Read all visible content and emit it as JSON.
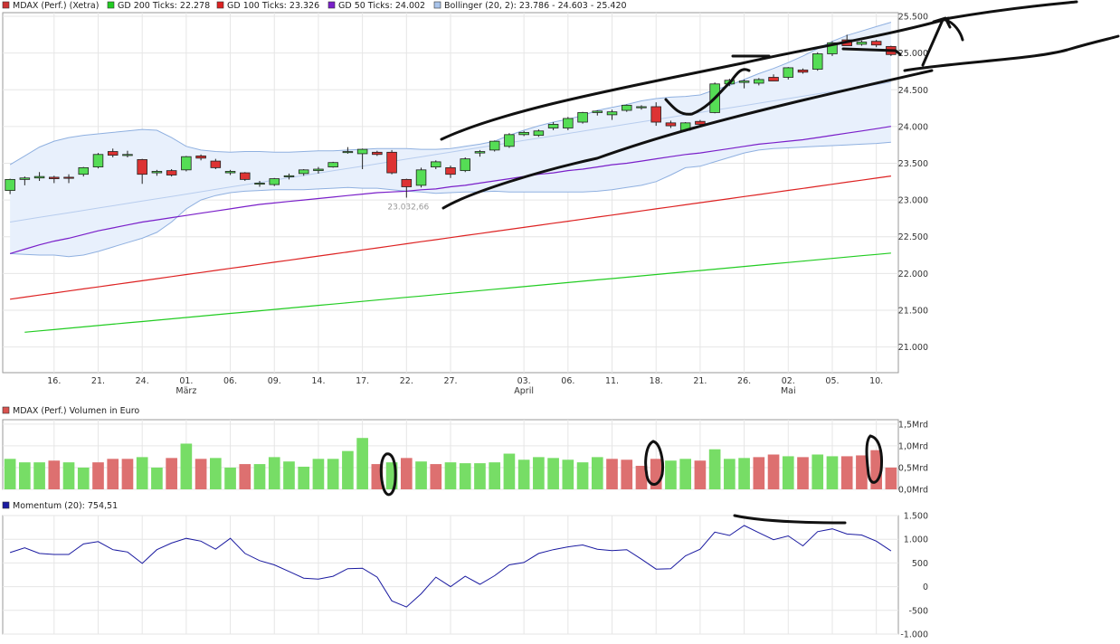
{
  "legend_main": [
    {
      "label": "MDAX (Perf.) (Xetra)",
      "color": "#333333"
    },
    {
      "label": "GD 200 Ticks: 22.278",
      "color": "#22cc22"
    },
    {
      "label": "GD 100 Ticks: 23.326",
      "color": "#dd2222"
    },
    {
      "label": "GD 50 Ticks: 24.002",
      "color": "#7a1fc9"
    },
    {
      "label": "Bollinger (20, 2): 23.786 - 24.603 - 25.420",
      "color": "#a9c4ea"
    }
  ],
  "legend_volume": {
    "label": "MDAX (Perf.) Volumen in Euro",
    "color": "#d9534f"
  },
  "legend_momentum": {
    "label": "Momentum (20): 754,51",
    "color": "#1a1aa0"
  },
  "annotations": {
    "low_label": "23.032,66"
  },
  "colors": {
    "up": "#55dd55",
    "down": "#dd3333",
    "vol_up": "#77dd66",
    "vol_down": "#dd7070",
    "gd200": "#22cc22",
    "gd100": "#dd2222",
    "gd50": "#7a1fc9",
    "boll_fill": "#e8f0fc",
    "boll_line": "#8fb0e0",
    "momentum": "#1a1aa0",
    "grid": "#e6e6e6"
  },
  "chart_data": [
    {
      "type": "candlestick",
      "title": "MDAX (Perf.) (Xetra)",
      "ylim": [
        20650,
        25550
      ],
      "y_ticks": [
        "21.000",
        "21.500",
        "22.000",
        "22.500",
        "23.000",
        "23.500",
        "24.000",
        "24.500",
        "25.000",
        "25.500"
      ],
      "y_tick_values": [
        21000,
        21500,
        22000,
        22500,
        23000,
        23500,
        24000,
        24500,
        25000,
        25500
      ],
      "x_ticks": [
        {
          "i": 3,
          "label": "16.",
          "sub": ""
        },
        {
          "i": 6,
          "label": "21.",
          "sub": ""
        },
        {
          "i": 9,
          "label": "24.",
          "sub": ""
        },
        {
          "i": 12,
          "label": "01.",
          "sub": "März"
        },
        {
          "i": 15,
          "label": "06.",
          "sub": ""
        },
        {
          "i": 18,
          "label": "09.",
          "sub": ""
        },
        {
          "i": 21,
          "label": "14.",
          "sub": ""
        },
        {
          "i": 24,
          "label": "17.",
          "sub": ""
        },
        {
          "i": 27,
          "label": "22.",
          "sub": ""
        },
        {
          "i": 30,
          "label": "27.",
          "sub": ""
        },
        {
          "i": 35,
          "label": "03.",
          "sub": "April"
        },
        {
          "i": 38,
          "label": "06.",
          "sub": ""
        },
        {
          "i": 41,
          "label": "11.",
          "sub": ""
        },
        {
          "i": 44,
          "label": "18.",
          "sub": ""
        },
        {
          "i": 47,
          "label": "21.",
          "sub": ""
        },
        {
          "i": 50,
          "label": "26.",
          "sub": ""
        },
        {
          "i": 53,
          "label": "02.",
          "sub": "Mai"
        },
        {
          "i": 56,
          "label": "05.",
          "sub": ""
        },
        {
          "i": 59,
          "label": "10.",
          "sub": ""
        }
      ],
      "candles": [
        {
          "o": 23130,
          "h": 23290,
          "l": 23080,
          "c": 23280
        },
        {
          "o": 23280,
          "h": 23320,
          "l": 23200,
          "c": 23300
        },
        {
          "o": 23300,
          "h": 23380,
          "l": 23260,
          "c": 23320
        },
        {
          "o": 23310,
          "h": 23330,
          "l": 23230,
          "c": 23290
        },
        {
          "o": 23310,
          "h": 23350,
          "l": 23230,
          "c": 23300
        },
        {
          "o": 23350,
          "h": 23450,
          "l": 23320,
          "c": 23440
        },
        {
          "o": 23450,
          "h": 23640,
          "l": 23430,
          "c": 23620
        },
        {
          "o": 23660,
          "h": 23700,
          "l": 23580,
          "c": 23610
        },
        {
          "o": 23610,
          "h": 23670,
          "l": 23580,
          "c": 23620
        },
        {
          "o": 23550,
          "h": 23560,
          "l": 23220,
          "c": 23350
        },
        {
          "o": 23370,
          "h": 23410,
          "l": 23330,
          "c": 23390
        },
        {
          "o": 23400,
          "h": 23420,
          "l": 23320,
          "c": 23340
        },
        {
          "o": 23410,
          "h": 23600,
          "l": 23390,
          "c": 23590
        },
        {
          "o": 23600,
          "h": 23620,
          "l": 23540,
          "c": 23570
        },
        {
          "o": 23530,
          "h": 23560,
          "l": 23420,
          "c": 23440
        },
        {
          "o": 23370,
          "h": 23410,
          "l": 23340,
          "c": 23390
        },
        {
          "o": 23370,
          "h": 23380,
          "l": 23260,
          "c": 23280
        },
        {
          "o": 23220,
          "h": 23260,
          "l": 23180,
          "c": 23230
        },
        {
          "o": 23210,
          "h": 23300,
          "l": 23190,
          "c": 23290
        },
        {
          "o": 23320,
          "h": 23360,
          "l": 23280,
          "c": 23330
        },
        {
          "o": 23360,
          "h": 23420,
          "l": 23330,
          "c": 23410
        },
        {
          "o": 23400,
          "h": 23450,
          "l": 23360,
          "c": 23420
        },
        {
          "o": 23450,
          "h": 23520,
          "l": 23440,
          "c": 23510
        },
        {
          "o": 23650,
          "h": 23720,
          "l": 23630,
          "c": 23660
        },
        {
          "o": 23630,
          "h": 23700,
          "l": 23420,
          "c": 23690
        },
        {
          "o": 23650,
          "h": 23670,
          "l": 23600,
          "c": 23620
        },
        {
          "o": 23650,
          "h": 23680,
          "l": 23350,
          "c": 23370
        },
        {
          "o": 23280,
          "h": 23290,
          "l": 23032,
          "c": 23180
        },
        {
          "o": 23200,
          "h": 23440,
          "l": 23170,
          "c": 23410
        },
        {
          "o": 23450,
          "h": 23540,
          "l": 23420,
          "c": 23520
        },
        {
          "o": 23440,
          "h": 23470,
          "l": 23300,
          "c": 23350
        },
        {
          "o": 23400,
          "h": 23580,
          "l": 23380,
          "c": 23560
        },
        {
          "o": 23640,
          "h": 23680,
          "l": 23590,
          "c": 23660
        },
        {
          "o": 23680,
          "h": 23810,
          "l": 23660,
          "c": 23800
        },
        {
          "o": 23730,
          "h": 23910,
          "l": 23710,
          "c": 23890
        },
        {
          "o": 23890,
          "h": 23940,
          "l": 23870,
          "c": 23920
        },
        {
          "o": 23880,
          "h": 23960,
          "l": 23860,
          "c": 23940
        },
        {
          "o": 23980,
          "h": 24060,
          "l": 23950,
          "c": 24030
        },
        {
          "o": 23980,
          "h": 24130,
          "l": 23950,
          "c": 24110
        },
        {
          "o": 24060,
          "h": 24200,
          "l": 24040,
          "c": 24190
        },
        {
          "o": 24190,
          "h": 24220,
          "l": 24150,
          "c": 24210
        },
        {
          "o": 24160,
          "h": 24230,
          "l": 24090,
          "c": 24200
        },
        {
          "o": 24220,
          "h": 24300,
          "l": 24200,
          "c": 24290
        },
        {
          "o": 24270,
          "h": 24290,
          "l": 24230,
          "c": 24270
        },
        {
          "o": 24270,
          "h": 24330,
          "l": 24010,
          "c": 24060
        },
        {
          "o": 24050,
          "h": 24080,
          "l": 23980,
          "c": 24010
        },
        {
          "o": 23950,
          "h": 24060,
          "l": 23930,
          "c": 24050
        },
        {
          "o": 24070,
          "h": 24090,
          "l": 24020,
          "c": 24030
        },
        {
          "o": 24190,
          "h": 24600,
          "l": 24180,
          "c": 24580
        },
        {
          "o": 24580,
          "h": 24650,
          "l": 24550,
          "c": 24630
        },
        {
          "o": 24600,
          "h": 24640,
          "l": 24520,
          "c": 24620
        },
        {
          "o": 24590,
          "h": 24660,
          "l": 24560,
          "c": 24640
        },
        {
          "o": 24670,
          "h": 24710,
          "l": 24620,
          "c": 24620
        },
        {
          "o": 24670,
          "h": 24810,
          "l": 24640,
          "c": 24800
        },
        {
          "o": 24770,
          "h": 24790,
          "l": 24720,
          "c": 24740
        },
        {
          "o": 24780,
          "h": 25010,
          "l": 24760,
          "c": 24990
        },
        {
          "o": 24990,
          "h": 25160,
          "l": 24960,
          "c": 25140
        },
        {
          "o": 25180,
          "h": 25250,
          "l": 25120,
          "c": 25100
        },
        {
          "o": 25120,
          "h": 25170,
          "l": 25100,
          "c": 25150
        },
        {
          "o": 25160,
          "h": 25180,
          "l": 25080,
          "c": 25110
        },
        {
          "o": 25090,
          "h": 25100,
          "l": 24960,
          "c": 24980
        }
      ],
      "gd200": {
        "from": 1,
        "start": 21200,
        "end": 22278
      },
      "gd100": {
        "from": 0,
        "start": 21650,
        "end": 23326
      },
      "gd50": [
        22270,
        22330,
        22390,
        22440,
        22480,
        22530,
        22580,
        22620,
        22660,
        22700,
        22730,
        22760,
        22790,
        22820,
        22850,
        22880,
        22910,
        22940,
        22960,
        22980,
        23000,
        23020,
        23040,
        23060,
        23080,
        23100,
        23110,
        23120,
        23140,
        23150,
        23180,
        23200,
        23230,
        23260,
        23290,
        23320,
        23350,
        23370,
        23400,
        23420,
        23450,
        23480,
        23500,
        23530,
        23560,
        23590,
        23620,
        23640,
        23670,
        23700,
        23730,
        23760,
        23780,
        23800,
        23820,
        23850,
        23880,
        23910,
        23940,
        23970,
        24002
      ],
      "bollinger_upper": [
        23480,
        23600,
        23720,
        23800,
        23850,
        23880,
        23900,
        23920,
        23940,
        23960,
        23950,
        23850,
        23730,
        23680,
        23660,
        23650,
        23660,
        23660,
        23650,
        23650,
        23660,
        23670,
        23670,
        23680,
        23690,
        23700,
        23700,
        23700,
        23690,
        23690,
        23700,
        23730,
        23760,
        23800,
        23880,
        23950,
        24010,
        24060,
        24100,
        24150,
        24220,
        24260,
        24300,
        24350,
        24380,
        24400,
        24410,
        24430,
        24500,
        24560,
        24640,
        24720,
        24790,
        24870,
        24960,
        25060,
        25160,
        25240,
        25300,
        25360,
        25420
      ],
      "bollinger_lower": [
        22270,
        22260,
        22250,
        22250,
        22230,
        22250,
        22300,
        22360,
        22420,
        22480,
        22560,
        22700,
        22880,
        23000,
        23060,
        23100,
        23120,
        23130,
        23140,
        23140,
        23140,
        23150,
        23160,
        23170,
        23160,
        23160,
        23140,
        23120,
        23110,
        23090,
        23100,
        23110,
        23110,
        23120,
        23110,
        23110,
        23110,
        23110,
        23110,
        23110,
        23120,
        23140,
        23170,
        23200,
        23250,
        23340,
        23440,
        23460,
        23520,
        23580,
        23640,
        23680,
        23700,
        23710,
        23720,
        23730,
        23740,
        23750,
        23760,
        23770,
        23786
      ],
      "bollinger_mid_start": 22700,
      "bollinger_mid_end": 24603
    },
    {
      "type": "bar",
      "title": "MDAX (Perf.) Volumen in Euro",
      "ylim": [
        0,
        1.6
      ],
      "y_ticks": [
        "0,0Mrd",
        "0,5Mrd",
        "1,0Mrd",
        "1,5Mrd"
      ],
      "y_tick_values": [
        0,
        0.5,
        1.0,
        1.5
      ],
      "unit": "Mrd",
      "values": [
        0.7,
        0.62,
        0.62,
        0.66,
        0.62,
        0.5,
        0.62,
        0.7,
        0.7,
        0.74,
        0.5,
        0.72,
        1.05,
        0.7,
        0.72,
        0.5,
        0.58,
        0.58,
        0.74,
        0.64,
        0.52,
        0.7,
        0.7,
        0.88,
        1.18,
        0.58,
        0.62,
        0.72,
        0.64,
        0.58,
        0.62,
        0.6,
        0.6,
        0.62,
        0.82,
        0.68,
        0.74,
        0.72,
        0.68,
        0.62,
        0.74,
        0.7,
        0.68,
        0.54,
        0.7,
        0.66,
        0.7,
        0.66,
        0.92,
        0.7,
        0.72,
        0.74,
        0.8,
        0.76,
        0.74,
        0.8,
        0.76,
        0.76,
        0.78,
        0.9,
        0.5
      ],
      "up": [
        true,
        true,
        true,
        false,
        true,
        true,
        false,
        false,
        false,
        true,
        true,
        false,
        true,
        false,
        true,
        true,
        false,
        true,
        true,
        true,
        true,
        true,
        true,
        true,
        true,
        false,
        true,
        false,
        true,
        false,
        true,
        true,
        true,
        true,
        true,
        true,
        true,
        true,
        true,
        true,
        true,
        false,
        false,
        false,
        false,
        true,
        true,
        false,
        true,
        true,
        true,
        false,
        false,
        true,
        false,
        true,
        true,
        false,
        false,
        false,
        false
      ]
    },
    {
      "type": "line",
      "title": "Momentum (20): 754,51",
      "ylim": [
        -1000,
        1500
      ],
      "y_ticks": [
        "-1.000",
        "-500",
        "0",
        "500",
        "1.000",
        "1.500"
      ],
      "y_tick_values": [
        -1000,
        -500,
        0,
        500,
        1000,
        1500
      ],
      "values": [
        720,
        820,
        700,
        680,
        680,
        900,
        950,
        780,
        730,
        490,
        780,
        920,
        1020,
        960,
        790,
        1020,
        700,
        550,
        460,
        320,
        180,
        160,
        220,
        380,
        390,
        200,
        -300,
        -430,
        -150,
        200,
        0,
        220,
        50,
        230,
        460,
        510,
        700,
        780,
        840,
        880,
        790,
        760,
        780,
        580,
        370,
        380,
        650,
        790,
        1150,
        1080,
        1290,
        1140,
        990,
        1070,
        860,
        1160,
        1220,
        1110,
        1090,
        960,
        754
      ]
    }
  ]
}
